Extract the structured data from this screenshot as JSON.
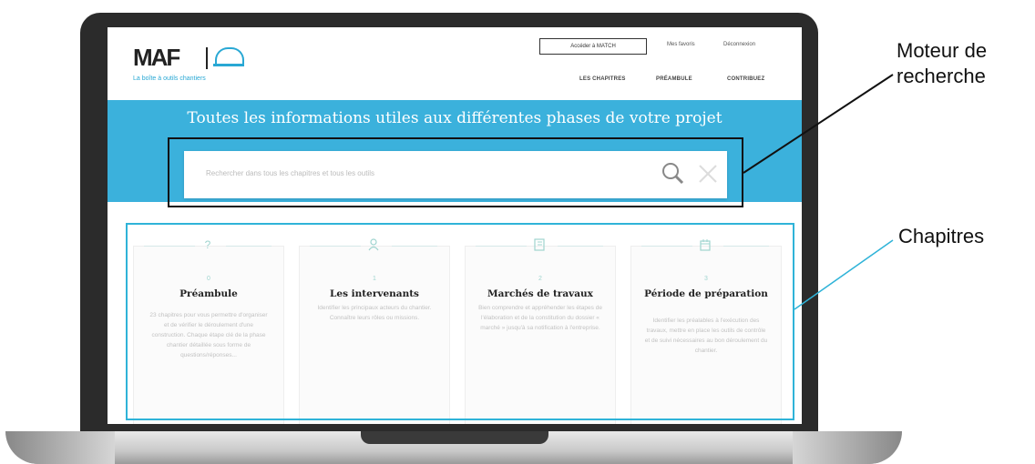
{
  "header": {
    "logo": "MAF",
    "tagline": "La boîte à outils chantiers",
    "access_button": "Accéder à MATCH",
    "util_links": [
      "Mes favoris",
      "Déconnexion"
    ],
    "nav": [
      "LES CHAPITRES",
      "PRÉAMBULE",
      "CONTRIBUEZ"
    ]
  },
  "hero": {
    "title": "Toutes les informations utiles aux différentes phases de votre projet",
    "search_placeholder": "Rechercher dans tous les chapitres et tous les outils"
  },
  "chapters": [
    {
      "icon": "question-icon",
      "number": "0",
      "title": "Préambule",
      "description": "23 chapitres pour vous permettre d'organiser et de vérifier le déroulement d'une construction. Chaque étape clé de la phase chantier détaillée sous forme de questions/réponses..."
    },
    {
      "icon": "people-icon",
      "number": "1",
      "title": "Les intervenants",
      "description": "Identifier les principaux acteurs du chantier. Connaître leurs rôles ou missions."
    },
    {
      "icon": "document-icon",
      "number": "2",
      "title": "Marchés de travaux",
      "description": "Bien comprendre et appréhender les étapes de l'élaboration et de la constitution du dossier « marché » jusqu'à sa notification à l'entreprise."
    },
    {
      "icon": "calendar-icon",
      "number": "3",
      "title": "Période de préparation",
      "description": "Identifier les préalables à l'exécution des travaux, mettre en place les outils de contrôle et de suivi nécessaires au bon déroulement du chantier."
    }
  ],
  "annotations": {
    "search_label_line1": "Moteur de",
    "search_label_line2": "recherche",
    "chapters_label": "Chapitres"
  },
  "colors": {
    "accent": "#3bb1dc",
    "frame_search": "#111111",
    "frame_chapters": "#2fb3d8"
  }
}
